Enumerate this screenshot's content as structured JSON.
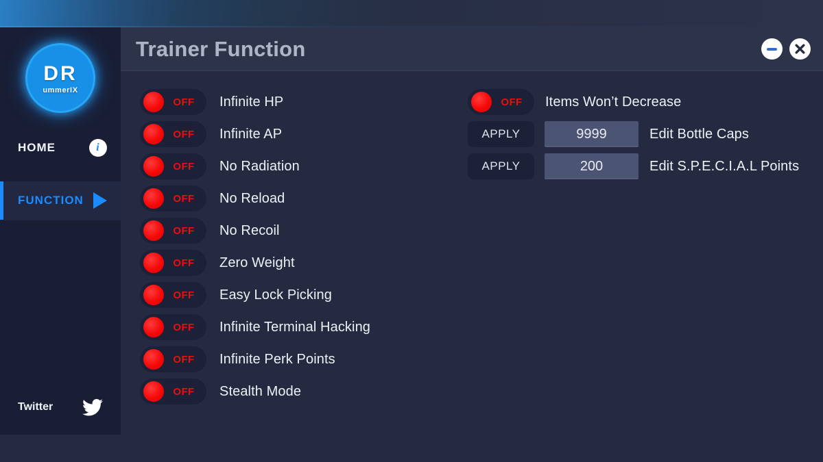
{
  "window": {
    "title": "Trainer Function",
    "minimize_label": "minimize",
    "close_label": "close"
  },
  "sidebar": {
    "logo": {
      "main_text": "DR",
      "sub_text": "ummerIX"
    },
    "items": [
      {
        "label": "HOME",
        "icon": "info-icon",
        "active": false
      },
      {
        "label": "FUNCTION",
        "icon": "play-icon",
        "active": true
      }
    ],
    "footer": {
      "label": "Twitter",
      "icon": "twitter-bird-icon"
    }
  },
  "content": {
    "left_column": [
      {
        "type": "toggle",
        "state": "OFF",
        "label": "Infinite HP"
      },
      {
        "type": "toggle",
        "state": "OFF",
        "label": "Infinite AP"
      },
      {
        "type": "toggle",
        "state": "OFF",
        "label": "No Radiation"
      },
      {
        "type": "toggle",
        "state": "OFF",
        "label": "No Reload"
      },
      {
        "type": "toggle",
        "state": "OFF",
        "label": "No Recoil"
      },
      {
        "type": "toggle",
        "state": "OFF",
        "label": "Zero Weight"
      },
      {
        "type": "toggle",
        "state": "OFF",
        "label": "Easy Lock Picking"
      },
      {
        "type": "toggle",
        "state": "OFF",
        "label": "Infinite Terminal Hacking"
      },
      {
        "type": "toggle",
        "state": "OFF",
        "label": "Infinite Perk Points"
      },
      {
        "type": "toggle",
        "state": "OFF",
        "label": "Stealth Mode"
      }
    ],
    "right_column": [
      {
        "type": "toggle",
        "state": "OFF",
        "label": "Items Won’t Decrease"
      },
      {
        "type": "apply",
        "button": "APPLY",
        "value": "9999",
        "label": "Edit Bottle Caps"
      },
      {
        "type": "apply",
        "button": "APPLY",
        "value": "200",
        "label": "Edit S.P.E.C.I.A.L Points"
      }
    ]
  },
  "colors": {
    "accent_blue": "#1a8cff",
    "toggle_red": "#ef0d0d",
    "sidebar_bg": "#191e35",
    "content_bg": "#252a41",
    "header_bg": "#2d3349",
    "field_bg": "#4c5473"
  }
}
